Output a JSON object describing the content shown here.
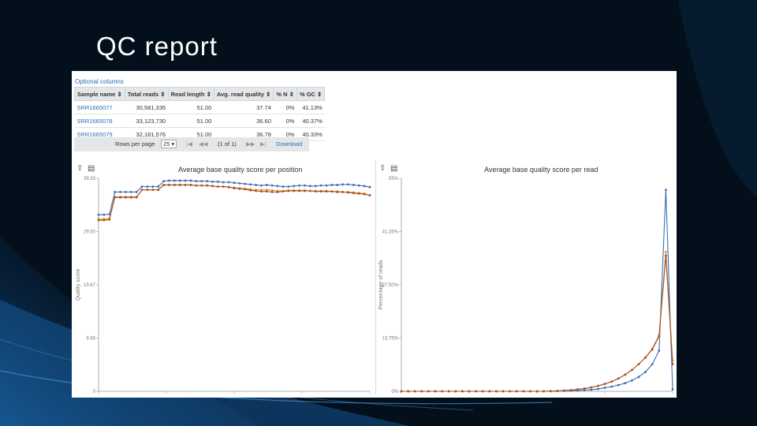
{
  "slide": {
    "title": "QC report"
  },
  "table": {
    "optional_columns": "Optional columns",
    "headers": [
      "Sample name ⇕",
      "Total reads ⇕",
      "Read length ⇕",
      "Avg. read quality ⇕",
      "% N ⇕",
      "% GC ⇕"
    ],
    "rows": [
      [
        "SRR1665077",
        "30,581,335",
        "51.00",
        "37.74",
        "0%",
        "41.13%"
      ],
      [
        "SRR1665078",
        "33,123,730",
        "51.00",
        "36.60",
        "0%",
        "40.37%"
      ],
      [
        "SRR1665079",
        "32,181,576",
        "51.00",
        "36.78",
        "0%",
        "40.33%"
      ]
    ],
    "pager": {
      "rows_per_page_label": "Rows per page",
      "rows_per_page_value": "25",
      "first": "|◀",
      "prev": "◀◀",
      "page_info": "(1 of 1)",
      "next": "▶▶",
      "last": "▶|",
      "download": "Download"
    }
  },
  "toolbar": {
    "export_icon": "export-icon",
    "data_icon": "data-icon"
  },
  "colors": {
    "blue": "#3a6db5",
    "orange": "#e8901e",
    "brown": "#a0522d"
  },
  "chart_data": [
    {
      "type": "line",
      "title": "Average base quality score per position",
      "xlabel": "",
      "ylabel": "Quality score",
      "ylim": [
        0,
        39.33
      ],
      "yticks": [
        "0",
        "9.83",
        "19.67",
        "29.50",
        "39.33"
      ],
      "x": [
        1,
        2,
        3,
        4,
        5,
        6,
        7,
        8,
        9,
        10,
        11,
        12,
        13,
        14,
        15,
        16,
        17,
        18,
        19,
        20,
        21,
        22,
        23,
        24,
        25,
        26,
        27,
        28,
        29,
        30,
        31,
        32,
        33,
        34,
        35,
        36,
        37,
        38,
        39,
        40,
        41,
        42,
        43,
        44,
        45,
        46,
        47,
        48,
        49,
        50,
        51
      ],
      "series": [
        {
          "name": "SRR1665077",
          "color": "#3a6db5",
          "values": [
            32.6,
            32.6,
            32.7,
            36.8,
            36.8,
            36.8,
            36.8,
            36.8,
            37.8,
            37.8,
            37.8,
            37.8,
            38.8,
            38.9,
            38.9,
            38.9,
            38.9,
            38.9,
            38.8,
            38.8,
            38.8,
            38.7,
            38.7,
            38.6,
            38.6,
            38.5,
            38.4,
            38.3,
            38.2,
            38.1,
            38.0,
            38.1,
            38.0,
            37.9,
            37.8,
            37.8,
            37.9,
            38.0,
            38.0,
            37.9,
            37.9,
            38.0,
            38.0,
            38.1,
            38.1,
            38.2,
            38.2,
            38.1,
            38.0,
            37.9,
            37.7
          ]
        },
        {
          "name": "SRR1665078",
          "color": "#e8901e",
          "values": [
            31.8,
            31.8,
            31.9,
            35.9,
            35.9,
            35.9,
            35.9,
            35.9,
            37.2,
            37.2,
            37.2,
            37.2,
            38.1,
            38.1,
            38.1,
            38.1,
            38.1,
            38.1,
            38.0,
            38.0,
            38.0,
            37.9,
            37.8,
            37.8,
            37.7,
            37.6,
            37.5,
            37.4,
            37.3,
            37.2,
            37.2,
            37.2,
            37.1,
            37.0,
            37.0,
            37.1,
            37.1,
            37.1,
            37.1,
            37.0,
            37.0,
            37.0,
            37.0,
            36.9,
            36.9,
            36.8,
            36.8,
            36.7,
            36.6,
            36.5,
            36.2
          ]
        },
        {
          "name": "SRR1665079",
          "color": "#a0522d",
          "values": [
            31.6,
            31.6,
            31.7,
            35.8,
            35.8,
            35.8,
            35.8,
            35.8,
            37.2,
            37.2,
            37.2,
            37.2,
            38.1,
            38.1,
            38.1,
            38.1,
            38.1,
            38.1,
            38.0,
            38.0,
            38.0,
            37.9,
            37.8,
            37.8,
            37.7,
            37.5,
            37.4,
            37.3,
            37.1,
            37.0,
            36.9,
            36.9,
            36.8,
            36.8,
            36.9,
            37.0,
            37.0,
            37.0,
            37.0,
            37.0,
            36.9,
            36.9,
            36.9,
            36.9,
            36.8,
            36.8,
            36.7,
            36.6,
            36.5,
            36.4,
            36.2
          ]
        }
      ]
    },
    {
      "type": "line",
      "title": "Average base quality score per read",
      "xlabel": "",
      "ylabel": "Percentage of reads",
      "ylim": [
        0,
        55
      ],
      "yticks": [
        "0%",
        "13.75%",
        "27.50%",
        "41.25%",
        "55%"
      ],
      "x": [
        0,
        1,
        2,
        3,
        4,
        5,
        6,
        7,
        8,
        9,
        10,
        11,
        12,
        13,
        14,
        15,
        16,
        17,
        18,
        19,
        20,
        21,
        22,
        23,
        24,
        25,
        26,
        27,
        28,
        29,
        30,
        31,
        32,
        33,
        34,
        35,
        36,
        37,
        38,
        39,
        40
      ],
      "series": [
        {
          "name": "SRR1665077",
          "color": "#3a6db5",
          "values": [
            0,
            0,
            0,
            0,
            0,
            0,
            0,
            0,
            0,
            0,
            0,
            0,
            0,
            0,
            0,
            0,
            0,
            0,
            0,
            0,
            0,
            0,
            0,
            0.05,
            0.1,
            0.15,
            0.2,
            0.3,
            0.4,
            0.6,
            0.9,
            1.2,
            1.6,
            2.1,
            2.8,
            3.7,
            5.0,
            7.0,
            10.5,
            52,
            0.5
          ]
        },
        {
          "name": "SRR1665078",
          "color": "#e8901e",
          "values": [
            0,
            0,
            0,
            0,
            0,
            0,
            0,
            0,
            0,
            0,
            0,
            0,
            0,
            0,
            0,
            0,
            0,
            0,
            0,
            0,
            0,
            0,
            0.05,
            0.1,
            0.2,
            0.3,
            0.5,
            0.7,
            1.0,
            1.4,
            1.9,
            2.5,
            3.3,
            4.3,
            5.5,
            7.0,
            8.8,
            11.0,
            14.5,
            36,
            8
          ]
        },
        {
          "name": "SRR1665079",
          "color": "#a0522d",
          "values": [
            0,
            0,
            0,
            0,
            0,
            0,
            0,
            0,
            0,
            0,
            0,
            0,
            0,
            0,
            0,
            0,
            0,
            0,
            0,
            0,
            0,
            0,
            0.05,
            0.1,
            0.2,
            0.3,
            0.5,
            0.7,
            1.0,
            1.4,
            1.9,
            2.5,
            3.3,
            4.3,
            5.5,
            7.0,
            8.7,
            10.8,
            14.2,
            35,
            7
          ]
        }
      ]
    }
  ]
}
